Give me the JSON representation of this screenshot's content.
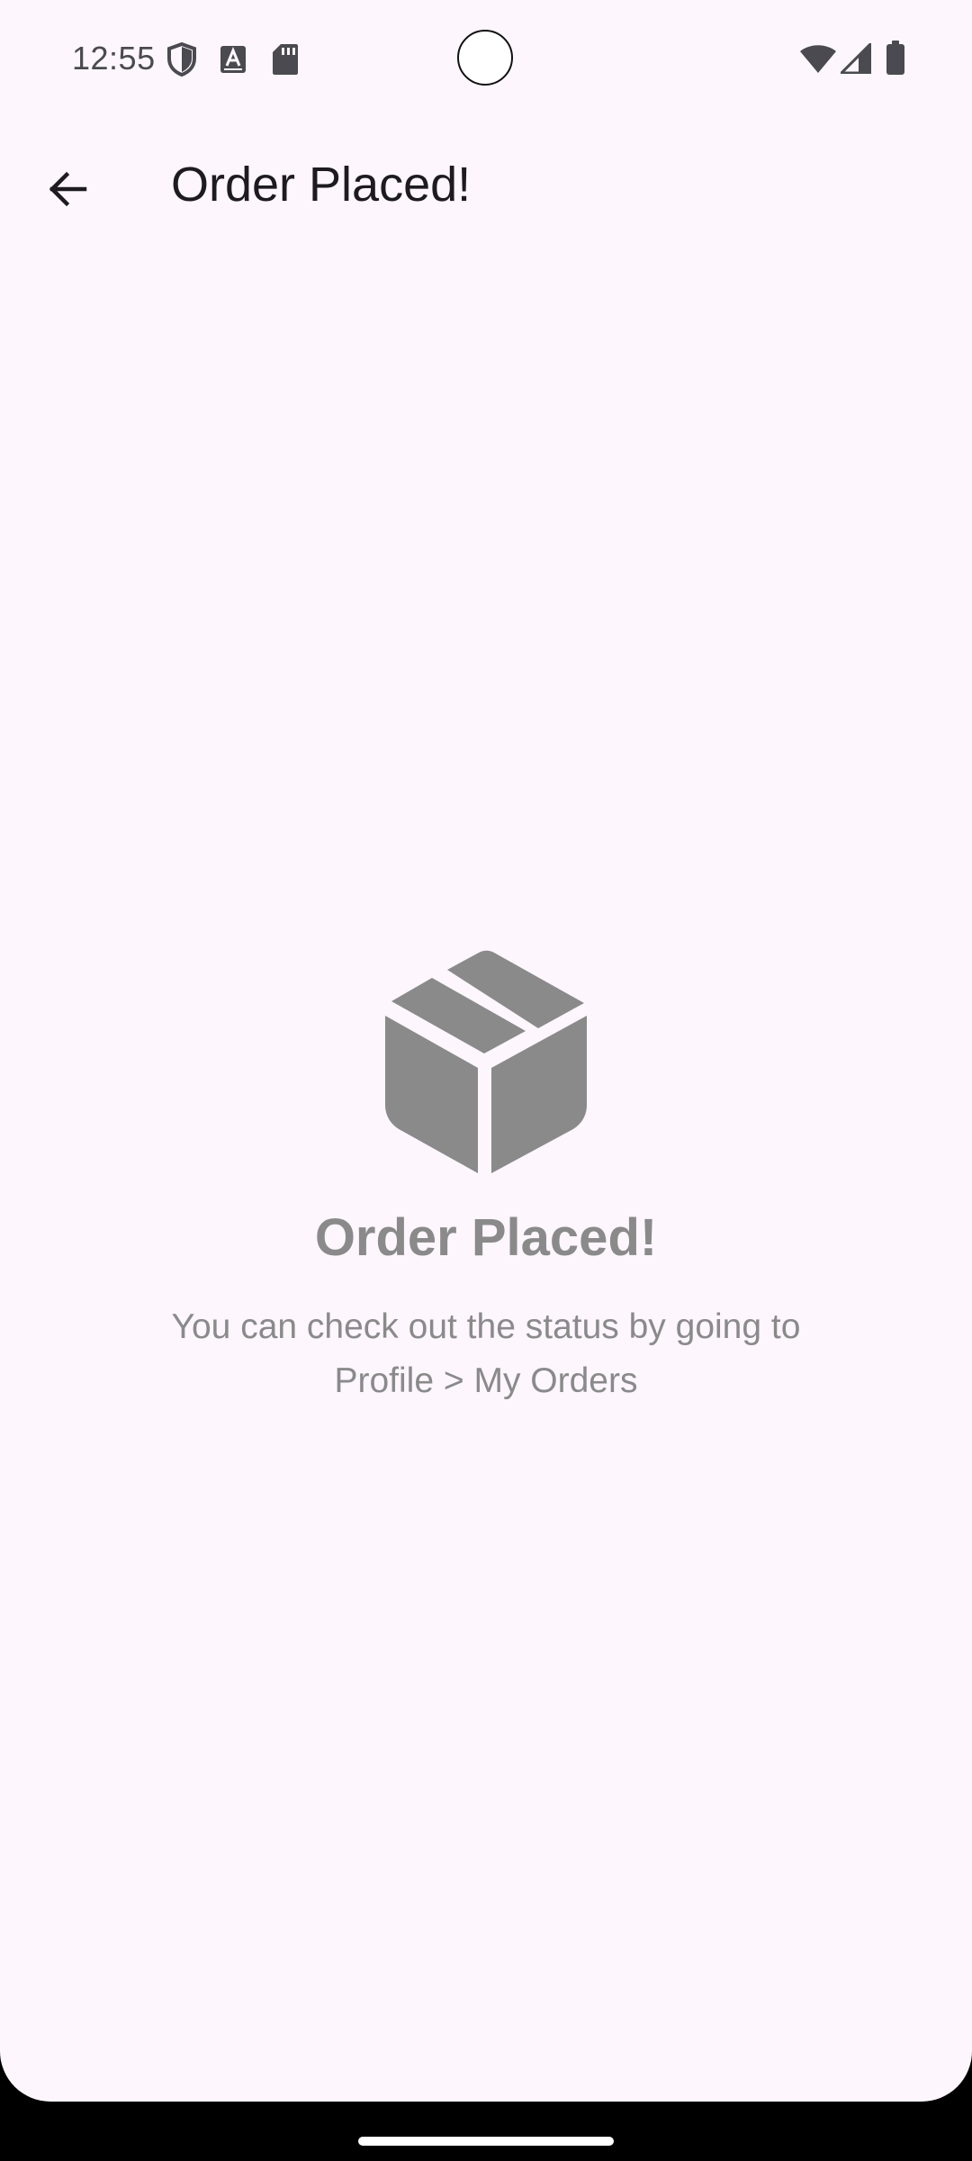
{
  "status_bar": {
    "time": "12:55",
    "left_icons": [
      "shield-icon",
      "text-a-icon",
      "sd-card-icon"
    ],
    "right_icons": [
      "wifi-icon",
      "cellular-icon",
      "battery-icon"
    ]
  },
  "app_bar": {
    "back_icon": "arrow-back-icon",
    "title": "Order Placed!"
  },
  "empty_state": {
    "icon": "package-box-icon",
    "headline": "Order Placed!",
    "message_line1": "You can check out the status by going to",
    "message_line2": "Profile > My Orders"
  },
  "colors": {
    "background": "#fdf6fd",
    "title_text": "#1d1b20",
    "muted_gray": "#8a8a8a"
  }
}
